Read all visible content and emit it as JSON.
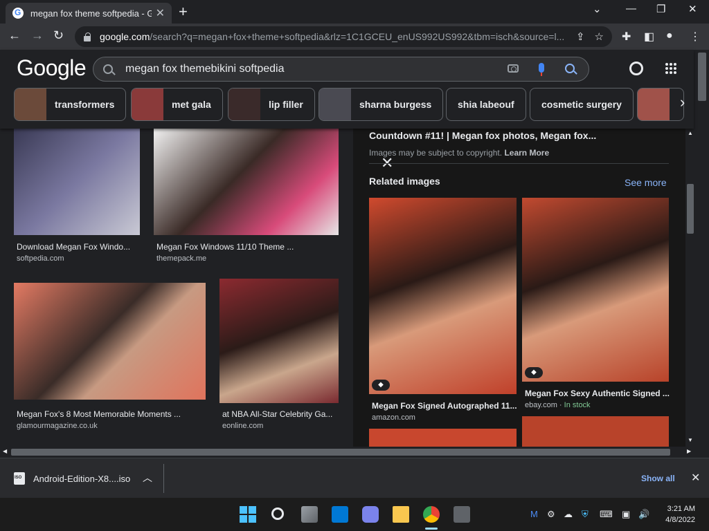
{
  "browser": {
    "tab_title": "megan fox theme softpedia - Go",
    "url_host": "google.com",
    "url_path": "/search?q=megan+fox+theme+softpedia&rlz=1C1GCEU_enUS992US992&tbm=isch&source=l..."
  },
  "google": {
    "logo": "Google",
    "query": "megan fox themebikini softpedia",
    "chips": [
      {
        "label": "transformers",
        "color": "#6b4a3a"
      },
      {
        "label": "met gala",
        "color": "#8a3a3a"
      },
      {
        "label": "lip filler",
        "color": "#3a2a2a"
      },
      {
        "label": "sharna burgess",
        "color": "#4a4a52"
      },
      {
        "label": "shia labeouf",
        "color": ""
      },
      {
        "label": "cosmetic surgery",
        "color": ""
      },
      {
        "label": "",
        "color": "#a0524a"
      }
    ]
  },
  "results": [
    {
      "title": "Download Megan Fox Windo...",
      "source": "softpedia.com",
      "color": "#6c6a8a"
    },
    {
      "title": "Megan Fox Windows 11/10 Theme ...",
      "source": "themepack.me",
      "color": "#c9496e"
    },
    {
      "title": "Megan Fox's 8 Most Memorable Moments ...",
      "source": "glamourmagazine.co.uk",
      "color": "#e0735c"
    },
    {
      "title": "at NBA All-Star Celebrity Ga...",
      "source": "eonline.com",
      "color": "#7a2a30"
    }
  ],
  "panel": {
    "title": "Countdown #11! | Megan fox photos, Megan fox...",
    "copyright": "Images may be subject to copyright.",
    "learn_more": "Learn More",
    "related_label": "Related images",
    "see_more": "See more",
    "related": [
      {
        "title": "Megan Fox Signed Autographed 11...",
        "source": "amazon.com",
        "stock": "",
        "color": "#c8472e"
      },
      {
        "title": "Megan Fox Sexy Authentic Signed ...",
        "source": "ebay.com",
        "stock": "In stock",
        "color": "#b8432a"
      }
    ]
  },
  "downloads": {
    "file": "Android-Edition-X8....iso",
    "show_all": "Show all"
  },
  "taskbar": {
    "time": "3:21 AM",
    "date": "4/8/2022"
  }
}
